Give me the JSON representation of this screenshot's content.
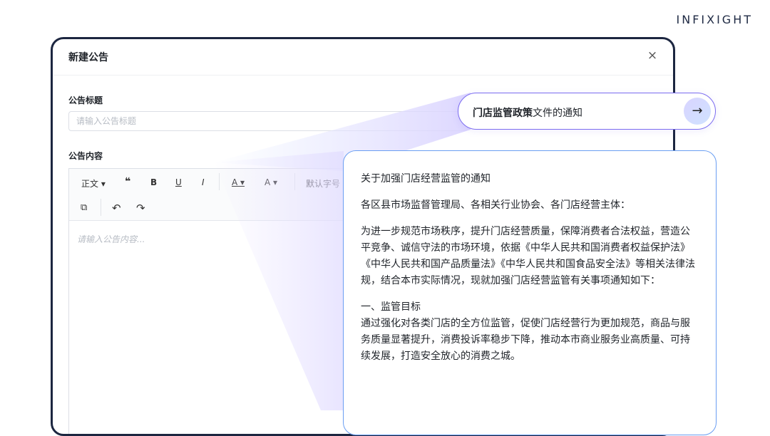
{
  "brand": "INFIXIGHT",
  "modal": {
    "title": "新建公告",
    "close_glyph": "×",
    "title_label": "公告标题",
    "title_placeholder": "请输入公告标题",
    "content_label": "公告内容",
    "content_placeholder": "请输入公告内容...",
    "toolbar": {
      "paragraph": "正文 ▾",
      "quote": "❝",
      "bold": "B",
      "underline": "U",
      "italic": "I",
      "font_color": "A ▾",
      "bg_color": "A ▾",
      "font_size": "默认字号 ▾",
      "image": "⧉",
      "undo": "↶",
      "redo": "↷"
    }
  },
  "suggestion": {
    "bold_part": "门店监管政策",
    "rest": "文件的通知",
    "arrow": "→"
  },
  "document": {
    "title": "关于加强门店经营监管的通知",
    "greeting": "各区县市场监督管理局、各相关行业协会、各门店经营主体：",
    "intro": "为进一步规范市场秩序，提升门店经营质量，保障消费者合法权益，营造公平竞争、诚信守法的市场环境，依据《中华人民共和国消费者权益保护法》《中华人民共和国产品质量法》《中华人民共和国食品安全法》等相关法律法规，结合本市实际情况，现就加强门店经营监管有关事项通知如下：",
    "section1_heading": "一、监管目标",
    "section1_body": "通过强化对各类门店的全方位监管，促使门店经营行为更加规范，商品与服务质量显著提升，消费投诉率稳步下降，推动本市商业服务业高质量、可持续发展，打造安全放心的消费之城。"
  }
}
